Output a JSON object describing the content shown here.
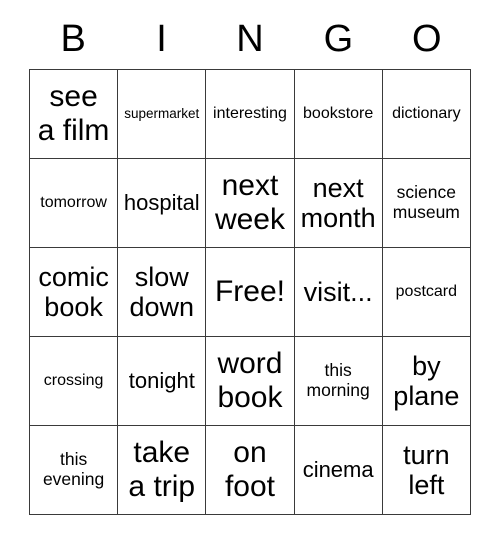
{
  "card": {
    "title": "BINGO",
    "header_letters": [
      "B",
      "I",
      "N",
      "G",
      "O"
    ],
    "free_space_label": "Free!",
    "rows": [
      [
        {
          "text": "see\na film",
          "size": "fs-xxl"
        },
        {
          "text": "supermarket",
          "size": "fs-xs"
        },
        {
          "text": "interesting",
          "size": "fs-sm"
        },
        {
          "text": "bookstore",
          "size": "fs-sm"
        },
        {
          "text": "dictionary",
          "size": "fs-sm"
        }
      ],
      [
        {
          "text": "tomorrow",
          "size": "fs-sm"
        },
        {
          "text": "hospital",
          "size": "fs-lg"
        },
        {
          "text": "next\nweek",
          "size": "fs-xxl"
        },
        {
          "text": "next\nmonth",
          "size": "fs-xl"
        },
        {
          "text": "science\nmuseum",
          "size": "fs-md"
        }
      ],
      [
        {
          "text": "comic\nbook",
          "size": "fs-xl"
        },
        {
          "text": "slow\ndown",
          "size": "fs-xl"
        },
        {
          "text": "Free!",
          "size": "fs-xxl"
        },
        {
          "text": "visit...",
          "size": "fs-xl"
        },
        {
          "text": "postcard",
          "size": "fs-sm"
        }
      ],
      [
        {
          "text": "crossing",
          "size": "fs-sm"
        },
        {
          "text": "tonight",
          "size": "fs-lg"
        },
        {
          "text": "word\nbook",
          "size": "fs-xxl"
        },
        {
          "text": "this\nmorning",
          "size": "fs-md"
        },
        {
          "text": "by\nplane",
          "size": "fs-xl"
        }
      ],
      [
        {
          "text": "this\nevening",
          "size": "fs-md"
        },
        {
          "text": "take\na trip",
          "size": "fs-xxl"
        },
        {
          "text": "on\nfoot",
          "size": "fs-xxl"
        },
        {
          "text": "cinema",
          "size": "fs-lg"
        },
        {
          "text": "turn\nleft",
          "size": "fs-xl"
        }
      ]
    ]
  },
  "colors": {
    "border": "#3a3a3a",
    "text": "#000000",
    "background": "#ffffff"
  }
}
